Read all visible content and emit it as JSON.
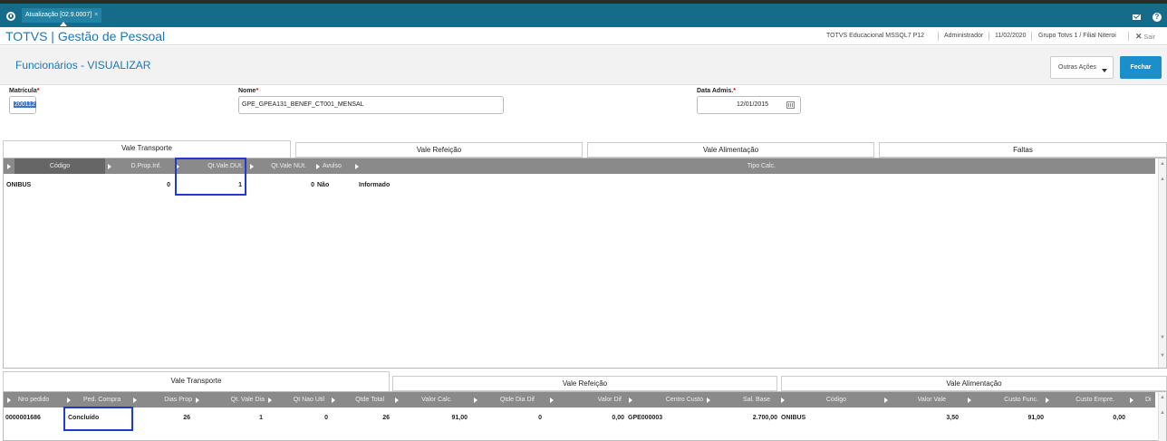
{
  "topbar": {
    "tab_label": "Atualização [02.9.0007]",
    "tab_close": "×"
  },
  "header": {
    "app_title": "TOTVS | Gestão de Pessoal",
    "environment": "TOTVS Educacional MSSQL7 P12",
    "user": "Administrador",
    "date": "11/02/2020",
    "company": "Grupo Totvs 1 / Filial Niteroi",
    "exit_label": "Sair"
  },
  "page": {
    "title": "Funcionários - VISUALIZAR",
    "actions_label": "Outras Ações",
    "close_label": "Fechar"
  },
  "form": {
    "matricula_label": "Matrícula",
    "matricula_value": "200112",
    "nome_label": "Nome",
    "nome_value": "GPE_GPEA131_BENEF_CT001_MENSAL",
    "data_label": "Data Admis.",
    "data_value": "12/01/2015",
    "required_mark": "*"
  },
  "top_tabs": [
    "Vale Transporte",
    "Vale Refeição",
    "Vale Alimentação",
    "Faltas"
  ],
  "top_grid": {
    "headers": [
      "Código",
      "D.Prop.Inf.",
      "Qt.Vale.DUt.",
      "Qt.Vale NUt.",
      "Avulso",
      "Tipo Calc."
    ],
    "row": {
      "codigo": "ONIBUS",
      "dprop": "0",
      "qt_dut": "1",
      "qt_nut": "0",
      "avulso": "Não",
      "tipo": "Informado"
    }
  },
  "bottom_tabs": [
    "Vale Transporte",
    "Vale Refeição",
    "Vale Alimentação"
  ],
  "bottom_grid": {
    "headers": [
      "Nro pedido",
      "Ped. Compra",
      "Dias Prop",
      "Qt. Vale Dia",
      "Qt Nao Util",
      "Qtde Total",
      "Valor Calc.",
      "Qtde Dia Dif",
      "Valor Dif",
      "Centro Custo",
      "Sal. Base",
      "Código",
      "Valor Vale",
      "Custo Func.",
      "Custo Empre.",
      "Di"
    ],
    "row": {
      "nro": "0000001686",
      "ped": "Concluído",
      "dias": "26",
      "qt_dia": "1",
      "qt_nao": "0",
      "qtde_total": "26",
      "valor_calc": "91,00",
      "qtde_dif": "0",
      "valor_dif": "0,00",
      "centro": "GPE000003",
      "sal_base": "2.700,00",
      "codigo": "ONIBUS",
      "valor_vale": "3,50",
      "custo_func": "91,00",
      "custo_emp": "0,00"
    }
  },
  "colors": {
    "titlebar": "#166a8a",
    "accent": "#1a78b4",
    "button": "#1a8fc9",
    "highlight": "#1f3bcf"
  }
}
